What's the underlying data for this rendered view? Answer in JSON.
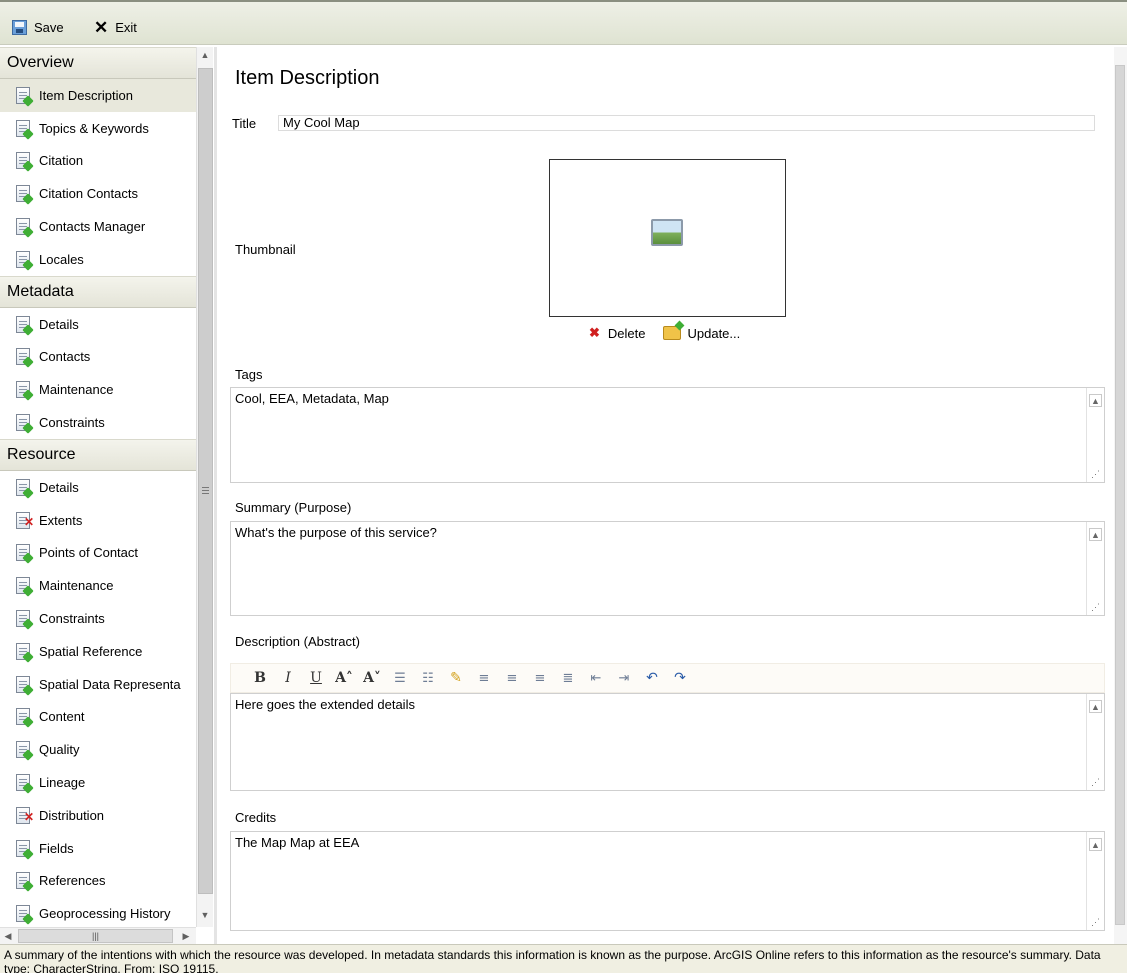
{
  "toolbar": {
    "save_label": "Save",
    "exit_label": "Exit"
  },
  "nav": {
    "sections": [
      {
        "label": "Overview",
        "items": [
          {
            "label": "Item Description",
            "icon": "document-valid-icon",
            "selected": true
          },
          {
            "label": "Topics & Keywords",
            "icon": "document-valid-icon"
          },
          {
            "label": "Citation",
            "icon": "document-valid-icon"
          },
          {
            "label": "Citation Contacts",
            "icon": "document-valid-icon"
          },
          {
            "label": "Contacts Manager",
            "icon": "document-icon"
          },
          {
            "label": "Locales",
            "icon": "document-valid-icon"
          }
        ]
      },
      {
        "label": "Metadata",
        "items": [
          {
            "label": "Details",
            "icon": "document-valid-icon"
          },
          {
            "label": "Contacts",
            "icon": "document-valid-icon"
          },
          {
            "label": "Maintenance",
            "icon": "document-valid-icon"
          },
          {
            "label": "Constraints",
            "icon": "document-valid-icon"
          }
        ]
      },
      {
        "label": "Resource",
        "items": [
          {
            "label": "Details",
            "icon": "document-valid-icon"
          },
          {
            "label": "Extents",
            "icon": "document-error-icon"
          },
          {
            "label": "Points of Contact",
            "icon": "document-valid-icon"
          },
          {
            "label": "Maintenance",
            "icon": "document-valid-icon"
          },
          {
            "label": "Constraints",
            "icon": "document-valid-icon"
          },
          {
            "label": "Spatial Reference",
            "icon": "document-valid-icon"
          },
          {
            "label": "Spatial Data Representa",
            "icon": "document-valid-icon"
          },
          {
            "label": "Content",
            "icon": "document-valid-icon"
          },
          {
            "label": "Quality",
            "icon": "document-valid-icon"
          },
          {
            "label": "Lineage",
            "icon": "document-valid-icon"
          },
          {
            "label": "Distribution",
            "icon": "document-error-icon"
          },
          {
            "label": "Fields",
            "icon": "document-valid-icon"
          },
          {
            "label": "References",
            "icon": "document-valid-icon"
          },
          {
            "label": "Geoprocessing History",
            "icon": "document-valid-icon"
          }
        ]
      }
    ]
  },
  "main": {
    "page_title": "Item Description",
    "title_label": "Title",
    "title_value": "My Cool Map",
    "thumbnail_label": "Thumbnail",
    "delete_label": "Delete",
    "update_label": "Update...",
    "tags_label": "Tags",
    "tags_value": "Cool, EEA, Metadata, Map",
    "summary_label": "Summary (Purpose)",
    "summary_value": "What's the purpose of this service?",
    "description_label": "Description (Abstract)",
    "description_value": "Here goes the extended details",
    "credits_label": "Credits",
    "credits_value": "The Map Map at EEA",
    "rte_buttons": [
      {
        "glyph": "B",
        "name": "bold-button",
        "style": "serif"
      },
      {
        "glyph": "I",
        "name": "italic-button",
        "style": "serif"
      },
      {
        "glyph": "U",
        "name": "underline-button",
        "style": "serif"
      },
      {
        "glyph": "A˄",
        "name": "increase-font-button",
        "style": "serif"
      },
      {
        "glyph": "A˅",
        "name": "decrease-font-button",
        "style": "serif"
      },
      {
        "glyph": "☰",
        "name": "bullet-list-button",
        "style": "gray"
      },
      {
        "glyph": "☷",
        "name": "numbered-list-button",
        "style": "gray"
      },
      {
        "glyph": "✎",
        "name": "highlight-button",
        "style": "gold"
      },
      {
        "glyph": "≡",
        "name": "align-left-button",
        "style": "gray"
      },
      {
        "glyph": "≡",
        "name": "align-center-button",
        "style": "gray"
      },
      {
        "glyph": "≡",
        "name": "align-right-button",
        "style": "gray"
      },
      {
        "glyph": "≣",
        "name": "justify-button",
        "style": "gray"
      },
      {
        "glyph": "⇤",
        "name": "outdent-button",
        "style": "gray"
      },
      {
        "glyph": "⇥",
        "name": "indent-button",
        "style": "gray"
      },
      {
        "glyph": "↶",
        "name": "undo-button",
        "style": "blue"
      },
      {
        "glyph": "↷",
        "name": "redo-button",
        "style": "blue"
      }
    ]
  },
  "status": {
    "text": "A summary of the intentions with which the resource was developed. In metadata standards this information is known as the purpose. ArcGIS Online refers to this information as the resource's summary. Data type: CharacterString. From: ISO 19115."
  },
  "colors": {
    "toolbar_bg": "#e5e8d9",
    "section_header_bg": "#ecece1",
    "selected_item_bg": "#e8e8dc",
    "status_bg": "#f0efe2",
    "error_red": "#d02020",
    "valid_green": "#3fae35"
  }
}
